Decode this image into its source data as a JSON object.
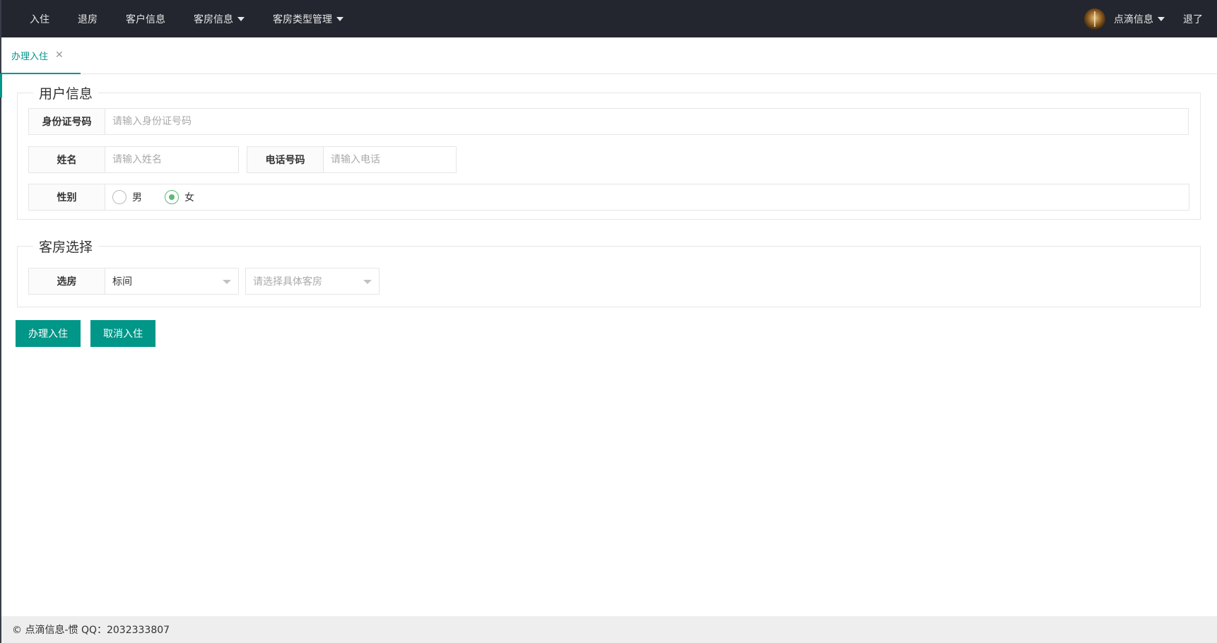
{
  "nav": {
    "items": [
      {
        "label": "入住",
        "has_dropdown": false
      },
      {
        "label": "退房",
        "has_dropdown": false
      },
      {
        "label": "客户信息",
        "has_dropdown": false
      },
      {
        "label": "客房信息",
        "has_dropdown": true
      },
      {
        "label": "客房类型管理",
        "has_dropdown": true
      }
    ],
    "user": {
      "name": "点滴信息",
      "avatar_icon": "avatar-image"
    },
    "logout_label": "退了"
  },
  "tabs": [
    {
      "label": "办理入住",
      "active": true,
      "close_icon": "close-icon"
    }
  ],
  "user_info": {
    "legend": "用户信息",
    "id_card": {
      "label": "身份证号码",
      "placeholder": "请输入身份证号码",
      "value": ""
    },
    "name": {
      "label": "姓名",
      "placeholder": "请输入姓名",
      "value": ""
    },
    "phone": {
      "label": "电话号码",
      "placeholder": "请输入电话",
      "value": ""
    },
    "gender": {
      "label": "性别",
      "options": [
        {
          "label": "男",
          "checked": false
        },
        {
          "label": "女",
          "checked": true
        }
      ]
    }
  },
  "room_select": {
    "legend": "客房选择",
    "label": "选房",
    "room_type": {
      "value": "标间"
    },
    "room": {
      "placeholder": "请选择具体客房",
      "value": ""
    }
  },
  "actions": {
    "submit_label": "办理入住",
    "cancel_label": "取消入住"
  },
  "footer": {
    "text": "© 点滴信息-惯 QQ：2032333807"
  },
  "colors": {
    "accent": "#009688",
    "radio_checked": "#5FB878",
    "topbar": "#23262E"
  }
}
